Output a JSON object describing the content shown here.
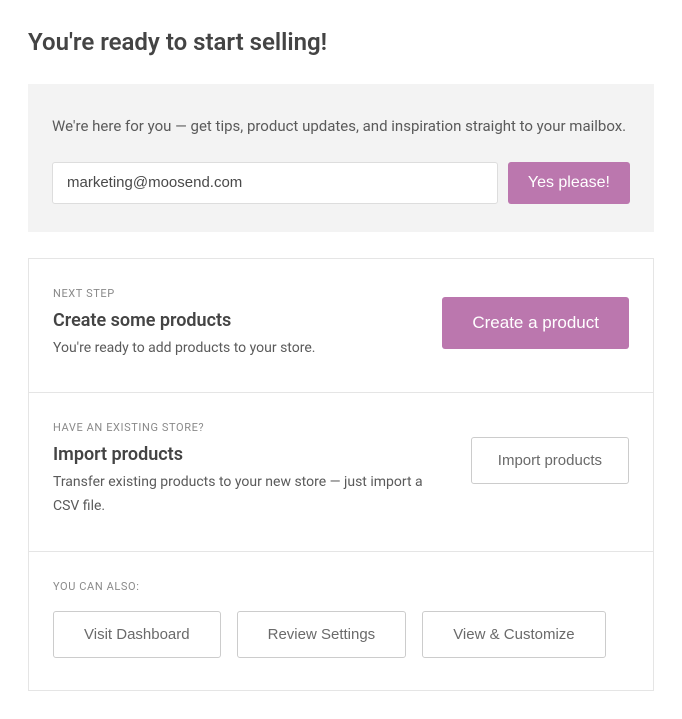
{
  "page_title": "You're ready to start selling!",
  "signup": {
    "text": "We're here for you — get tips, product updates, and inspiration straight to your mailbox.",
    "email_value": "marketing@moosend.com",
    "button_label": "Yes please!"
  },
  "next_step": {
    "eyebrow": "NEXT STEP",
    "title": "Create some products",
    "desc": "You're ready to add products to your store.",
    "button_label": "Create a product"
  },
  "import": {
    "eyebrow": "HAVE AN EXISTING STORE?",
    "title": "Import products",
    "desc": "Transfer existing products to your new store — just import a CSV file.",
    "button_label": "Import products"
  },
  "footer": {
    "eyebrow": "YOU CAN ALSO:",
    "buttons": {
      "dashboard": "Visit Dashboard",
      "review": "Review Settings",
      "customize": "View & Customize"
    }
  }
}
